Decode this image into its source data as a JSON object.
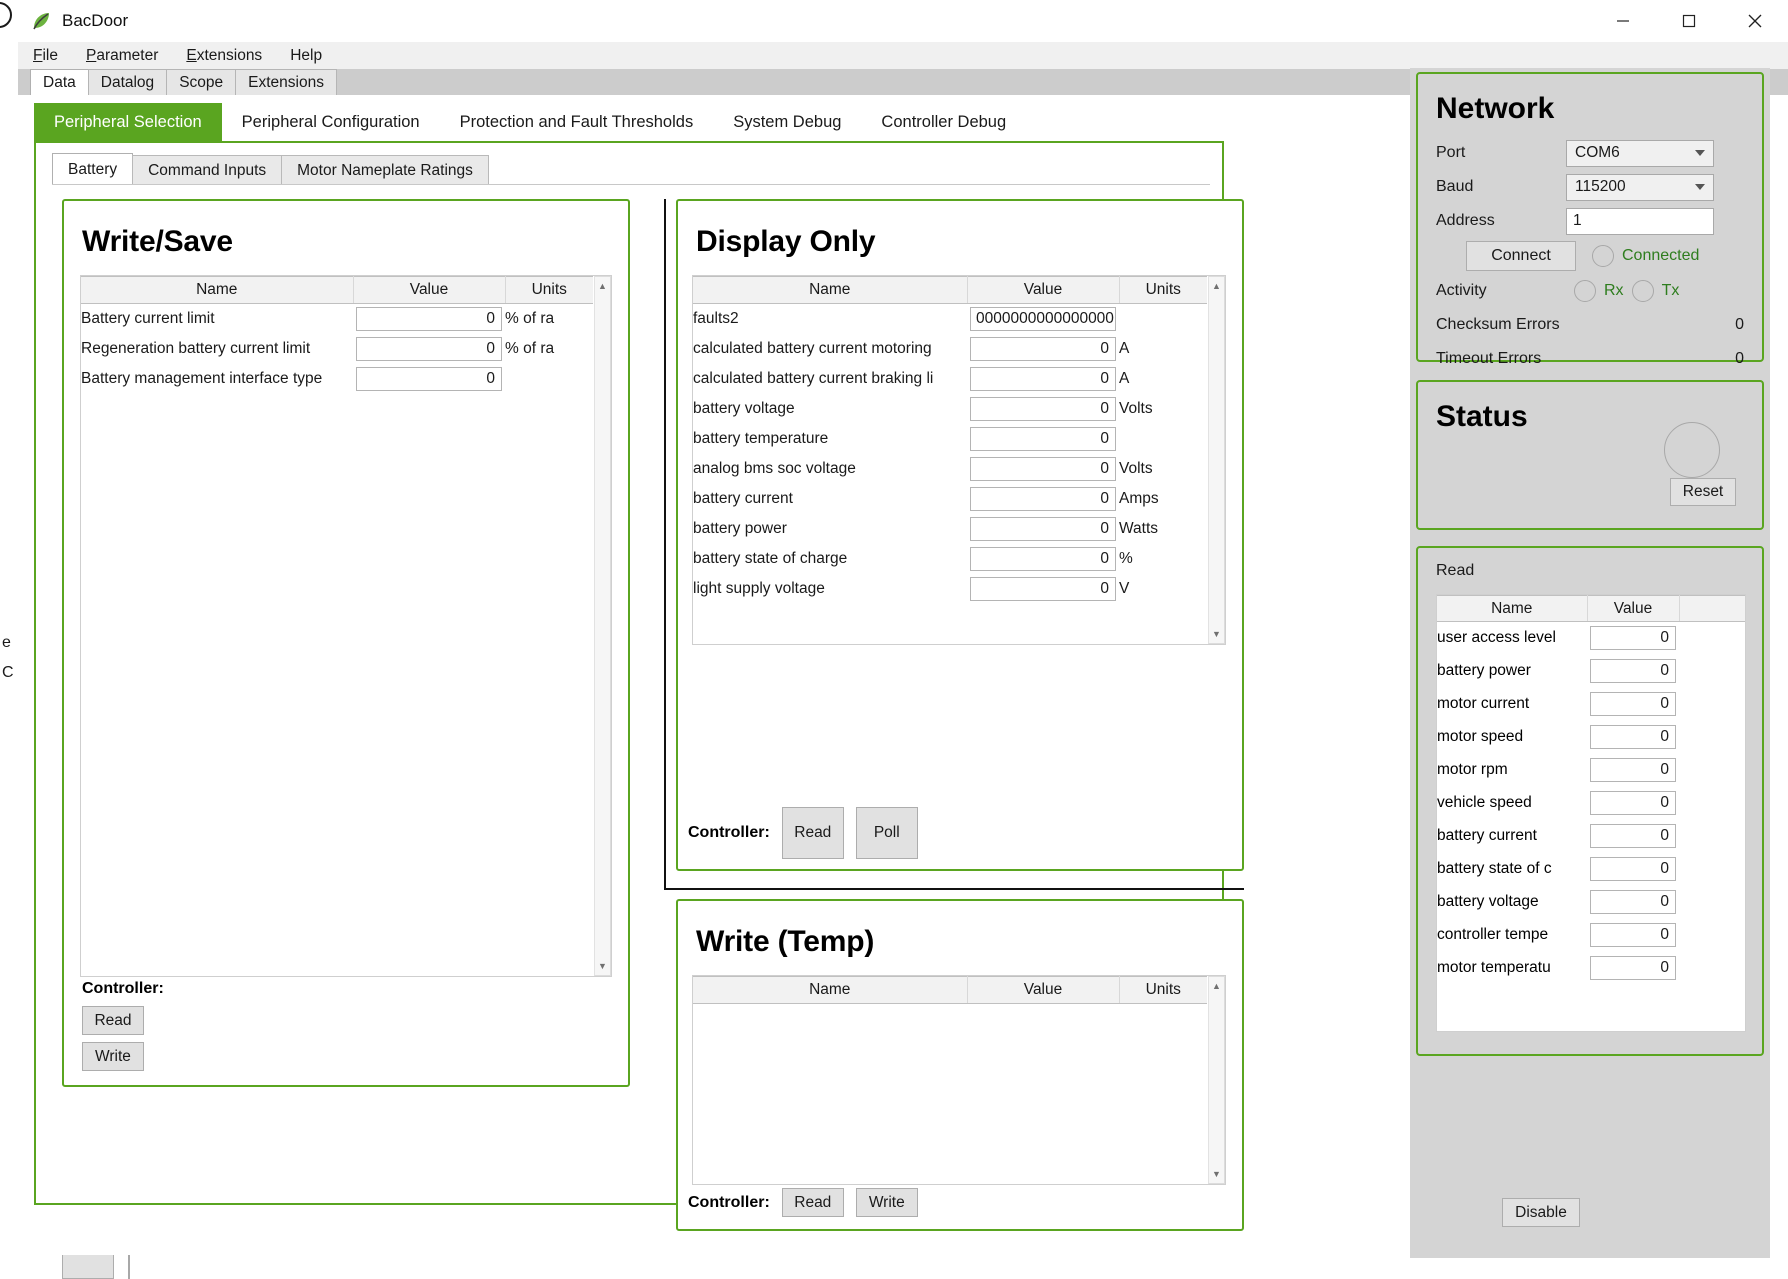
{
  "window": {
    "title": "BacDoor",
    "icon": "leaf-icon",
    "minimize": "minimize-icon",
    "maximize": "maximize-icon",
    "close": "close-icon"
  },
  "menubar": {
    "items": [
      "File",
      "Parameter",
      "Extensions",
      "Help"
    ]
  },
  "top_tabs": {
    "items": [
      "Data",
      "Datalog",
      "Scope",
      "Extensions"
    ],
    "active": "Data"
  },
  "section_tabs": {
    "items": [
      "Peripheral Selection",
      "Peripheral Configuration",
      "Protection and Fault Thresholds",
      "System Debug",
      "Controller Debug"
    ],
    "active": "Peripheral Selection",
    "active_color": "#5aa520"
  },
  "sub_tabs": {
    "items": [
      "Battery",
      "Command Inputs",
      "Motor Nameplate Ratings"
    ],
    "active": "Battery"
  },
  "write_save": {
    "title": "Write/Save",
    "columns": [
      "Name",
      "Value",
      "Units"
    ],
    "rows": [
      {
        "name": "Battery current limit",
        "value": "0",
        "units": "% of ra"
      },
      {
        "name": "Regeneration battery current limit",
        "value": "0",
        "units": "% of ra"
      },
      {
        "name": "Battery management interface type",
        "value": "0",
        "units": ""
      }
    ],
    "controller_label": "Controller:",
    "read_label": "Read",
    "write_label": "Write"
  },
  "display_only": {
    "title": "Display Only",
    "columns": [
      "Name",
      "Value",
      "Units"
    ],
    "rows": [
      {
        "name": "faults2",
        "value": "0000000000000000",
        "units": ""
      },
      {
        "name": "calculated battery current motoring",
        "value": "0",
        "units": "A"
      },
      {
        "name": "calculated battery current braking li",
        "value": "0",
        "units": "A"
      },
      {
        "name": "battery voltage",
        "value": "0",
        "units": "Volts"
      },
      {
        "name": "battery temperature",
        "value": "0",
        "units": ""
      },
      {
        "name": "analog bms soc voltage",
        "value": "0",
        "units": "Volts"
      },
      {
        "name": "battery current",
        "value": "0",
        "units": "Amps"
      },
      {
        "name": "battery power",
        "value": "0",
        "units": "Watts"
      },
      {
        "name": "battery state of charge",
        "value": "0",
        "units": "%"
      },
      {
        "name": "light supply voltage",
        "value": "0",
        "units": "V"
      }
    ],
    "controller_label": "Controller:",
    "read_label": "Read",
    "poll_label": "Poll"
  },
  "write_temp": {
    "title": "Write (Temp)",
    "columns": [
      "Name",
      "Value",
      "Units"
    ],
    "rows": [],
    "controller_label": "Controller:",
    "read_label": "Read",
    "write_label": "Write"
  },
  "network": {
    "title": "Network",
    "port_label": "Port",
    "port_value": "COM6",
    "baud_label": "Baud",
    "baud_value": "115200",
    "address_label": "Address",
    "address_value": "1",
    "connect_label": "Connect",
    "connected_label": "Connected",
    "connected_color": "#2e7d1e",
    "activity_label": "Activity",
    "rx_label": "Rx",
    "tx_label": "Tx",
    "checksum_errors_label": "Checksum Errors",
    "checksum_errors_value": "0",
    "timeout_errors_label": "Timeout Errors",
    "timeout_errors_value": "0"
  },
  "status": {
    "title": "Status",
    "reset_label": "Reset"
  },
  "read_panel": {
    "title": "Read",
    "columns": [
      "Name",
      "Value"
    ],
    "rows": [
      {
        "name": "user access level",
        "value": "0"
      },
      {
        "name": "battery power",
        "value": "0"
      },
      {
        "name": "motor current",
        "value": "0"
      },
      {
        "name": "motor speed",
        "value": "0"
      },
      {
        "name": "motor rpm",
        "value": "0"
      },
      {
        "name": "vehicle speed",
        "value": "0"
      },
      {
        "name": "battery current",
        "value": "0"
      },
      {
        "name": "battery state of c",
        "value": "0"
      },
      {
        "name": "battery voltage",
        "value": "0"
      },
      {
        "name": "controller tempe",
        "value": "0"
      },
      {
        "name": "motor temperatu",
        "value": "0"
      }
    ],
    "disable_label": "Disable"
  },
  "edge_text": {
    "line1": "e",
    "line2": "C"
  }
}
